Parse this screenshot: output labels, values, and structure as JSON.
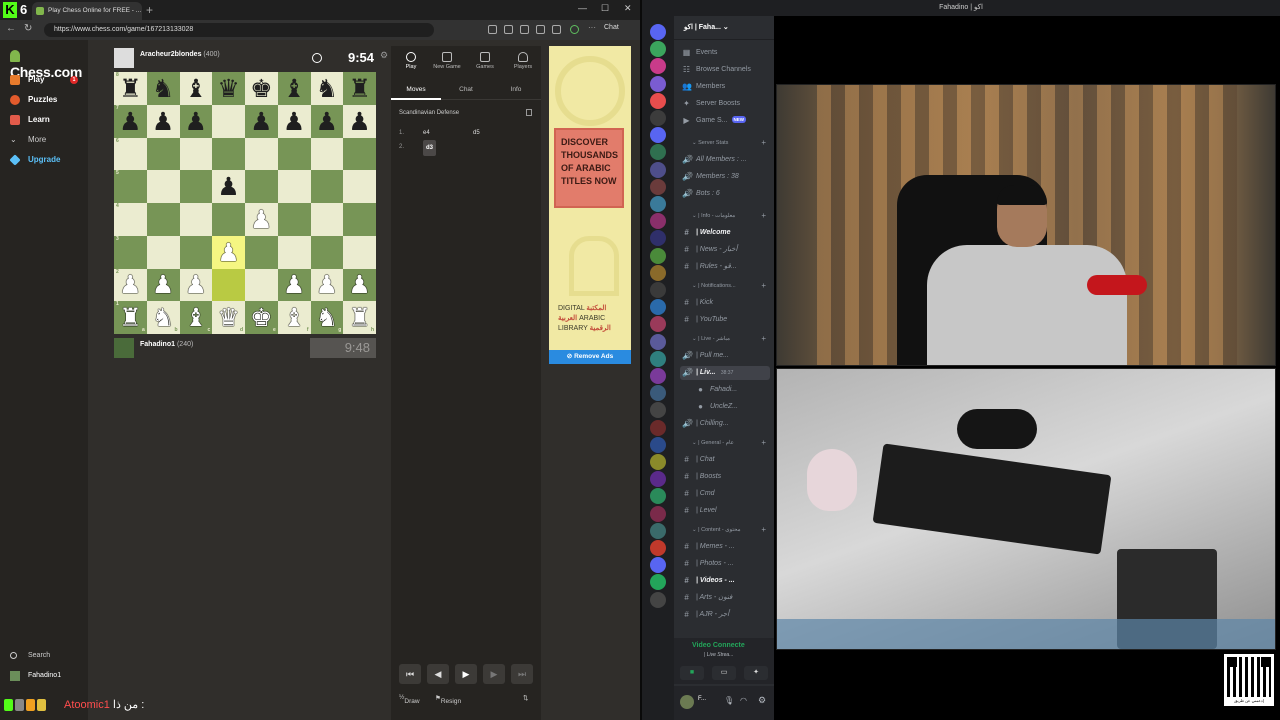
{
  "browser": {
    "kick_badge": "6",
    "tab_title": "Play Chess Online for FREE - ...",
    "url": "https://www.chess.com/game/167213133028",
    "chat_label": "Chat"
  },
  "sidebar": {
    "logo": "Chess.com",
    "items": [
      {
        "label": "Play",
        "badge": "1"
      },
      {
        "label": "Puzzles"
      },
      {
        "label": "Learn"
      },
      {
        "label": "More"
      },
      {
        "label": "Upgrade"
      }
    ],
    "search": "Search",
    "user": "Fahadino1"
  },
  "game": {
    "top_player": {
      "name": "Aracheur2blondes",
      "rating": "(400)"
    },
    "top_clock": "9:54",
    "bottom_player": {
      "name": "Fahadino1",
      "rating": "(240)"
    },
    "bottom_clock": "9:48",
    "board": [
      [
        "bR",
        "bN",
        "bB",
        "bQ",
        "bK",
        "bB",
        "bN",
        "bR"
      ],
      [
        "bP",
        "bP",
        "bP",
        "",
        "bP",
        "bP",
        "bP",
        "bP"
      ],
      [
        "",
        "",
        "",
        "",
        "",
        "",
        "",
        ""
      ],
      [
        "",
        "",
        "",
        "bP",
        "",
        "",
        "",
        ""
      ],
      [
        "",
        "",
        "",
        "",
        "wP",
        "",
        "",
        ""
      ],
      [
        "",
        "",
        "",
        "wP",
        "",
        "",
        "",
        ""
      ],
      [
        "wP",
        "wP",
        "wP",
        "",
        "",
        "wP",
        "wP",
        "wP"
      ],
      [
        "wR",
        "wN",
        "wB",
        "wQ",
        "wK",
        "wB",
        "wN",
        "wR"
      ]
    ],
    "highlight": [
      [
        5,
        3
      ],
      [
        6,
        3
      ]
    ],
    "ranks": [
      "8",
      "7",
      "6",
      "5",
      "4",
      "3",
      "2",
      "1"
    ],
    "files": [
      "a",
      "b",
      "c",
      "d",
      "e",
      "f",
      "g",
      "h"
    ]
  },
  "panel": {
    "tabs": [
      {
        "label": "Play"
      },
      {
        "label": "New Game"
      },
      {
        "label": "Games"
      },
      {
        "label": "Players"
      }
    ],
    "subtabs": [
      "Moves",
      "Chat",
      "Info"
    ],
    "opening": "Scandinavian Defense",
    "moves": [
      {
        "no": "1.",
        "white": "e4",
        "black": "d5"
      },
      {
        "no": "2.",
        "white": "d3",
        "black": ""
      }
    ],
    "draw": "Draw",
    "resign": "Resign"
  },
  "ad": {
    "headline": "DISCOVER THOUSANDS OF ARABIC TITLES NOW",
    "brand_line1": "DIGITAL",
    "brand_ar1": "المكتبة",
    "brand_line2": "ARABIC",
    "brand_ar2": "العربية",
    "brand_line3": "LIBRARY",
    "brand_ar3": "الرقمية",
    "remove": "Remove Ads"
  },
  "kick_chat": {
    "user": "Atoomic1",
    "message": "من ذا :"
  },
  "discord": {
    "window_title": "Fahadino | اكو",
    "guild": "اكو | Faha...",
    "top_items": [
      {
        "label": "Events",
        "icon": "calendar-icon"
      },
      {
        "label": "Browse Channels",
        "icon": "browse-icon"
      },
      {
        "label": "Members",
        "icon": "members-icon"
      },
      {
        "label": "Server Boosts",
        "icon": "boost-icon"
      },
      {
        "label": "Game S...",
        "icon": "game-icon",
        "badge": "NEW"
      }
    ],
    "stats_cat": "Server Stats",
    "stats": [
      "All Members : ...",
      "Members : 38",
      "Bots : 6"
    ],
    "info_cat": "| Info - معلومات",
    "info": [
      "| Welcome",
      "| News - أخبار",
      "| Rules - قو..."
    ],
    "notif_cat": "| Notifications...",
    "notif": [
      "| Kick",
      "| YouTube"
    ],
    "live_cat": "| Live - مباشر",
    "live": [
      {
        "label": "| Pull me..."
      },
      {
        "label": "| Liv...",
        "time": "38:37"
      },
      {
        "label": "Fahadi..."
      },
      {
        "label": "UncleZ..."
      },
      {
        "label": "| Chilling..."
      }
    ],
    "general_cat": "| General - عام",
    "general": [
      "| Chat",
      "| Boosts",
      "| Cmd",
      "| Level"
    ],
    "content_cat": "| Content - محتوى",
    "content": [
      "| Memes - ...",
      "| Photos - ...",
      "| Videos - ...",
      "| Arts - فنون",
      "| AJR - أجر"
    ],
    "voice_title": "Video Connecte",
    "voice_sub": "| Live Strea...",
    "user_name": "F...",
    "qr_caption": "إدعمني عن طريق"
  }
}
